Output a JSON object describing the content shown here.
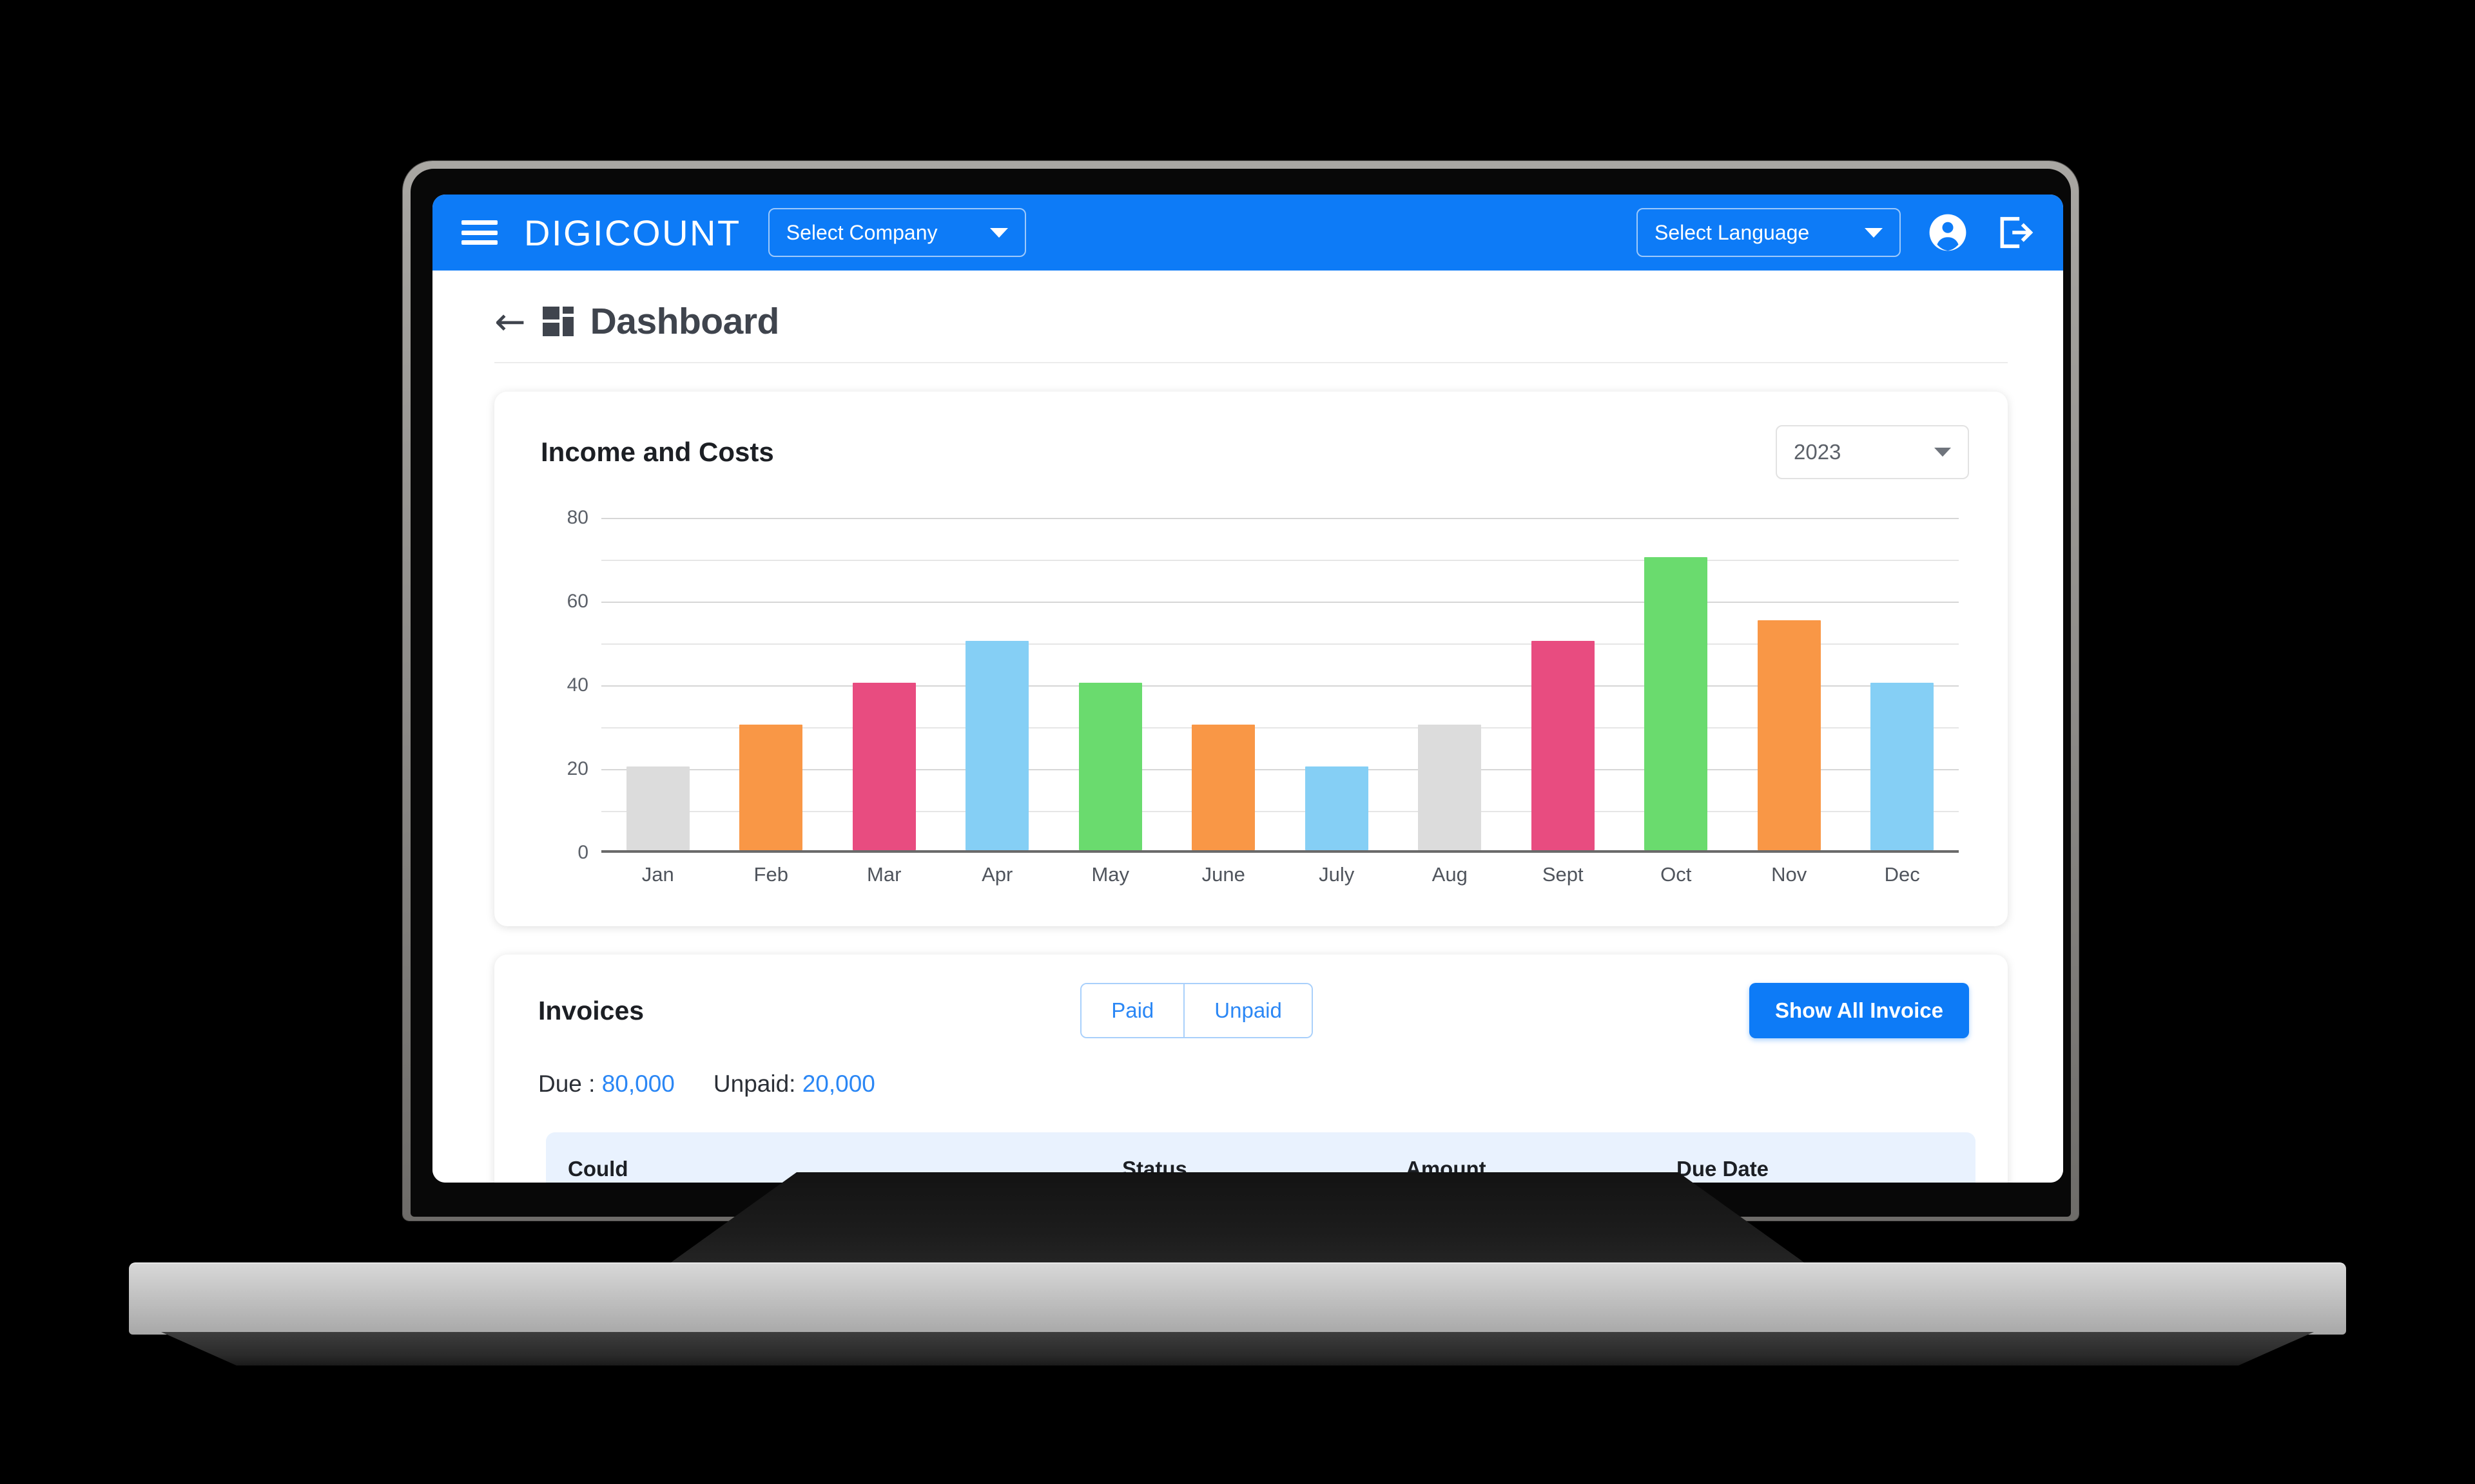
{
  "header": {
    "menu_icon": "hamburger-icon",
    "brand": "DIGICOUNT",
    "company_select": {
      "label": "Select Company",
      "caret": "chevron-down-icon"
    },
    "language_select": {
      "label": "Select Language",
      "caret": "chevron-down-icon"
    },
    "account_icon": "account-circle-icon",
    "logout_icon": "logout-icon",
    "accent_color": "#0d7bf7"
  },
  "page": {
    "back_arrow": "←",
    "dashboard_icon": "dashboard-grid-icon",
    "title": "Dashboard"
  },
  "chart_card": {
    "title": "Income and Costs",
    "year_select": {
      "value": "2023",
      "caret": "chevron-down-icon"
    }
  },
  "chart_data": {
    "type": "bar",
    "title": "Income and Costs",
    "xlabel": "",
    "ylabel": "",
    "ylim": [
      0,
      80
    ],
    "yticks": [
      0,
      20,
      40,
      60,
      80
    ],
    "minor_gridlines": [
      10,
      30,
      50,
      70
    ],
    "grid": true,
    "legend": null,
    "categories": [
      "Jan",
      "Feb",
      "Mar",
      "Apr",
      "May",
      "June",
      "July",
      "Aug",
      "Sept",
      "Oct",
      "Nov",
      "Dec"
    ],
    "values": [
      20,
      30,
      40,
      50,
      40,
      30,
      20,
      30,
      50,
      70,
      55,
      40
    ],
    "colors": [
      "#dcdcdc",
      "#f99746",
      "#e84c80",
      "#85cff5",
      "#6adb6e",
      "#f99746",
      "#85cff5",
      "#dcdcdc",
      "#e84c80",
      "#6adb6e",
      "#f99746",
      "#85cff5"
    ]
  },
  "invoices": {
    "title": "Invoices",
    "toggle": {
      "paid": "Paid",
      "unpaid": "Unpaid"
    },
    "show_all_button": "Show All Invoice",
    "due_label": "Due :",
    "due_value": "80,000",
    "unpaid_label": "Unpaid:",
    "unpaid_value": "20,000",
    "table_headers": [
      "Could",
      "Status",
      "Amount",
      "Due Date"
    ]
  }
}
